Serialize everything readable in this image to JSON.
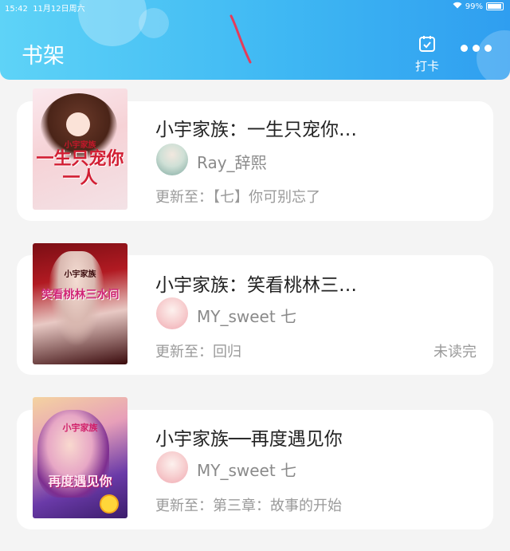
{
  "status_bar": {
    "time": "15:42",
    "date": "11月12日周六",
    "battery": "99%"
  },
  "header": {
    "title": "书架",
    "checkin_label": "打卡",
    "accent": "#3fb8f3"
  },
  "books": [
    {
      "title": "小宇家族：一生只宠你…",
      "author": "Ray_辞熙",
      "update": "更新至：【七】你可别忘了",
      "status": "",
      "cover_text_top": "小宇家族",
      "cover_text_main": "一生只宠你一人"
    },
    {
      "title": "小宇家族：笑看桃林三…",
      "author": "MY_sweet 七",
      "update": "更新至：回归",
      "status": "未读完",
      "cover_text_top": "小宇家族",
      "cover_text_main": "笑看桃林三水间"
    },
    {
      "title": "小宇家族──再度遇见你",
      "author": "MY_sweet 七",
      "update": "更新至：第三章：故事的开始",
      "status": "",
      "cover_text_top": "小宇家族",
      "cover_text_main": "再度遇见你"
    }
  ]
}
